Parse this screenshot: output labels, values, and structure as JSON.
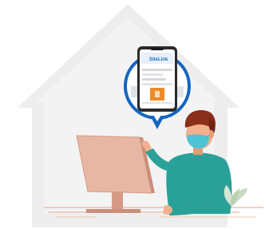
{
  "phone": {
    "app_logo": "SiteLink",
    "logo_color": "#1f6fb5",
    "accent": "#1565c0"
  },
  "colors": {
    "house": "#ececed",
    "monitor": "#e8b7a4",
    "shirt": "#2aa198",
    "skin": "#f2b08c",
    "hair": "#8b2e1a",
    "mask": "#4fc3d6",
    "floor": "#e9a38a"
  },
  "icons": [
    "house-shape",
    "phone-icon",
    "user-illustration",
    "computer-monitor",
    "plant-icon"
  ]
}
